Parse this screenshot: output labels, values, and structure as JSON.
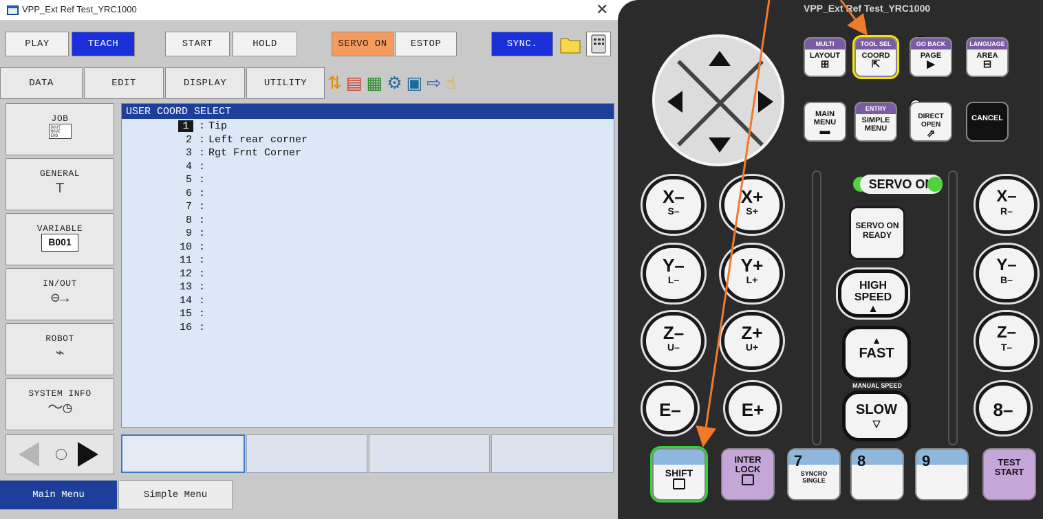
{
  "window": {
    "title": "VPP_Ext Ref Test_YRC1000",
    "close": "✕"
  },
  "toolbar_row1": {
    "play": "PLAY",
    "teach": "TEACH",
    "start": "START",
    "hold": "HOLD",
    "servo_on": "SERVO ON",
    "estop": "ESTOP",
    "sync": "SYNC."
  },
  "toolbar_row2": {
    "data": "DATA",
    "edit": "EDIT",
    "display": "DISPLAY",
    "utility": "UTILITY"
  },
  "sidebar": {
    "job": "JOB",
    "job_doc": "DOUT MOVE END",
    "general": "GENERAL",
    "variable": "VARIABLE",
    "variable_box": "B001",
    "inout": "IN/OUT",
    "robot": "ROBOT",
    "system_info": "SYSTEM INFO"
  },
  "panel": {
    "title": "USER COORD SELECT",
    "rows": [
      {
        "num": "1",
        "name": "Tip",
        "selected": true
      },
      {
        "num": "2",
        "name": "Left rear corner"
      },
      {
        "num": "3",
        "name": "Rgt Frnt Corner"
      },
      {
        "num": "4",
        "name": ""
      },
      {
        "num": "5",
        "name": ""
      },
      {
        "num": "6",
        "name": ""
      },
      {
        "num": "7",
        "name": ""
      },
      {
        "num": "8",
        "name": ""
      },
      {
        "num": "9",
        "name": ""
      },
      {
        "num": "10",
        "name": ""
      },
      {
        "num": "11",
        "name": ""
      },
      {
        "num": "12",
        "name": ""
      },
      {
        "num": "13",
        "name": ""
      },
      {
        "num": "14",
        "name": ""
      },
      {
        "num": "15",
        "name": ""
      },
      {
        "num": "16",
        "name": ""
      }
    ]
  },
  "bottom_tabs": {
    "main_menu": "Main Menu",
    "simple_menu": "Simple Menu"
  },
  "keypad": {
    "title": "VPP_Ext Ref Test_YRC1000",
    "multi": "MULTI",
    "layout": "LAYOUT",
    "toolsel": "TOOL SEL",
    "coord": "COORD",
    "goback": "GO BACK",
    "page": "PAGE",
    "language": "LANGUAGE",
    "area": "AREA",
    "main_menu": "MAIN MENU",
    "entry": "ENTRY",
    "simple_menu": "SIMPLE MENU",
    "direct_open": "DIRECT OPEN",
    "cancel": "CANCEL",
    "servo_on": "SERVO ON",
    "servo_ready": "SERVO ON READY",
    "high_speed": "HIGH SPEED",
    "fast": "FAST",
    "manual_speed": "MANUAL SPEED",
    "slow": "SLOW",
    "xm": "X–",
    "xm2": "S–",
    "xp": "X+",
    "xp2": "S+",
    "ym": "Y–",
    "ym2": "L–",
    "yp": "Y+",
    "yp2": "L+",
    "zm": "Z–",
    "zm2": "U–",
    "zp": "Z+",
    "zp2": "U+",
    "em": "E–",
    "ep": "E+",
    "rx": "X–",
    "rx2": "R–",
    "ry": "Y–",
    "ry2": "B–",
    "rz": "Z–",
    "rz2": "T–",
    "eight_minus": "8–",
    "shift": "SHIFT",
    "interlock": "INTER LOCK",
    "seven": "7",
    "syncro": "SYNCRO SINGLE",
    "eight": "8",
    "nine": "9",
    "test_start": "TEST START"
  },
  "colors": {
    "accent_orange": "#f07a2a",
    "highlight_green": "#2dd63a",
    "highlight_yellow": "#f7e400"
  }
}
